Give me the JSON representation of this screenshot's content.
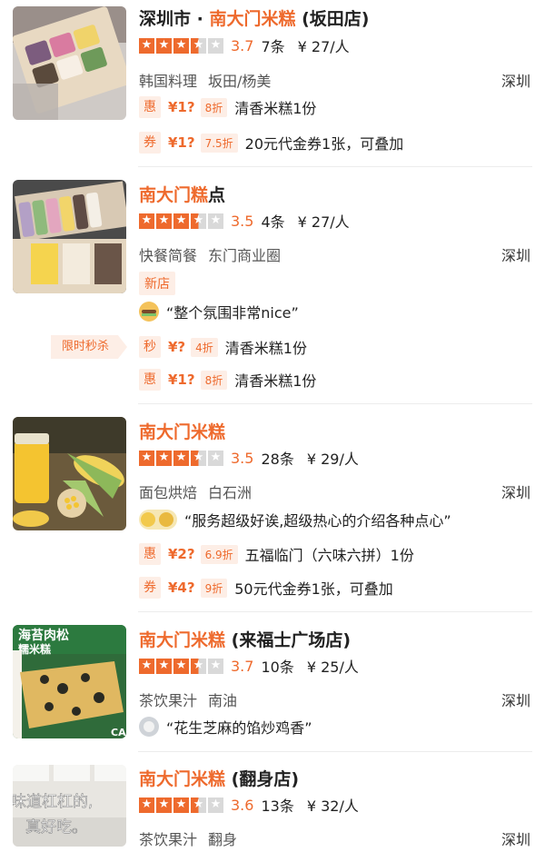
{
  "listings": [
    {
      "title_prefix": "深圳市 · ",
      "title_highlight": "南大门米糕",
      "title_suffix": " (坂田店)",
      "score": "3.7",
      "reviews": "7条",
      "price": "¥ 27/人",
      "category": "韩国料理",
      "area": "坂田/杨美",
      "city": "深圳",
      "deals": [
        {
          "tag": "惠",
          "price": "¥1?",
          "discount": "8折",
          "text": "清香米糕1份"
        },
        {
          "tag": "券",
          "price": "¥1?",
          "discount": "7.5折",
          "text": "20元代金券1张，可叠加"
        }
      ]
    },
    {
      "title_highlight": "南大门糕",
      "title_suffix": "点",
      "score": "3.5",
      "reviews": "4条",
      "price": "¥ 27/人",
      "category": "快餐简餐",
      "area": "东门商业圈",
      "city": "深圳",
      "new_tag": "新店",
      "review_quote": "“整个氛围非常nice”",
      "flash_label": "限时秒杀",
      "deals": [
        {
          "tag": "秒",
          "price": "¥?",
          "discount": "4折",
          "text": "清香米糕1份"
        },
        {
          "tag": "惠",
          "price": "¥1?",
          "discount": "8折",
          "text": "清香米糕1份"
        }
      ]
    },
    {
      "title_highlight": "南大门米糕",
      "score": "3.5",
      "reviews": "28条",
      "price": "¥ 29/人",
      "category": "面包烘焙",
      "area": "白石洲",
      "city": "深圳",
      "review_quote": "“服务超级好诶,超级热心的介绍各种点心”",
      "deals": [
        {
          "tag": "惠",
          "price": "¥2?",
          "discount": "6.9折",
          "text": "五福临门（六味六拼）1份"
        },
        {
          "tag": "券",
          "price": "¥4?",
          "discount": "9折",
          "text": "50元代金券1张，可叠加"
        }
      ]
    },
    {
      "title_highlight": "南大门米糕",
      "title_suffix": " (来福士广场店)",
      "score": "3.7",
      "reviews": "10条",
      "price": "¥ 25/人",
      "category": "茶饮果汁",
      "area": "南油",
      "city": "深圳",
      "image_text_1": "海苔肉松",
      "image_text_2": "糯米糕",
      "image_text_3": "CA",
      "review_quote": "“花生芝麻的馅炒鸡香”"
    },
    {
      "title_highlight": "南大门米糕",
      "title_suffix": " (翻身店)",
      "score": "3.6",
      "reviews": "13条",
      "price": "¥ 32/人",
      "category": "茶饮果汁",
      "area": "翻身",
      "city": "深圳",
      "image_text_1": "味道杠杠的,",
      "image_text_2": "真好吃。"
    }
  ],
  "colors": {
    "accent": "#ee6a2d",
    "tag_bg": "#fdeee6",
    "star_empty": "#d9d9d9"
  },
  "icons": {
    "star": "star-icon",
    "avatar": "avatar-icon"
  }
}
